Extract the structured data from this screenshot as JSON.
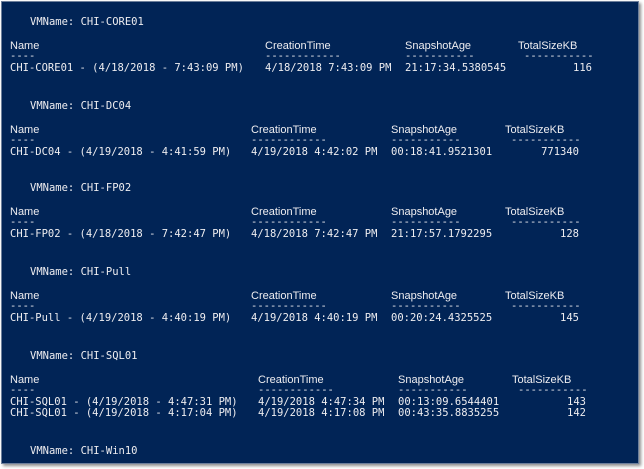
{
  "console": {
    "label_vmname": "VMName:",
    "headers": {
      "name": "Name",
      "creation": "CreationTime",
      "age": "SnapshotAge",
      "size": "TotalSizeKB"
    },
    "separators": {
      "name": "----",
      "creation": "------------",
      "age": "-----------",
      "size": "-----------"
    },
    "groups": [
      {
        "vm": "CHI-CORE01",
        "rows": [
          {
            "name": "CHI-CORE01 - (4/18/2018 - 7:43:09 PM)",
            "creation": "4/18/2018 7:43:09 PM",
            "age": "21:17:34.5380545",
            "size": "116"
          }
        ]
      },
      {
        "vm": "CHI-DC04",
        "rows": [
          {
            "name": "CHI-DC04 - (4/19/2018 - 4:41:59 PM)",
            "creation": "4/19/2018 4:42:02 PM",
            "age": "00:18:41.9521301",
            "size": "771340"
          }
        ]
      },
      {
        "vm": "CHI-FP02",
        "rows": [
          {
            "name": "CHI-FP02 - (4/18/2018 - 7:42:47 PM)",
            "creation": "4/18/2018 7:42:47 PM",
            "age": "21:17:57.1792295",
            "size": "128"
          }
        ]
      },
      {
        "vm": "CHI-Pull",
        "rows": [
          {
            "name": "CHI-Pull - (4/19/2018 - 4:40:19 PM)",
            "creation": "4/19/2018 4:40:19 PM",
            "age": "00:20:24.4325525",
            "size": "145"
          }
        ]
      },
      {
        "vm": "CHI-SQL01",
        "rows": [
          {
            "name": "CHI-SQL01 - (4/19/2018 - 4:47:31 PM)",
            "creation": "4/19/2018 4:47:34 PM",
            "age": "00:13:09.6544401",
            "size": "143"
          },
          {
            "name": "CHI-SQL01 - (4/19/2018 - 4:17:04 PM)",
            "creation": "4/19/2018 4:17:08 PM",
            "age": "00:43:35.8835255",
            "size": "142"
          }
        ]
      },
      {
        "vm": "CHI-Win10",
        "rows": []
      }
    ]
  }
}
